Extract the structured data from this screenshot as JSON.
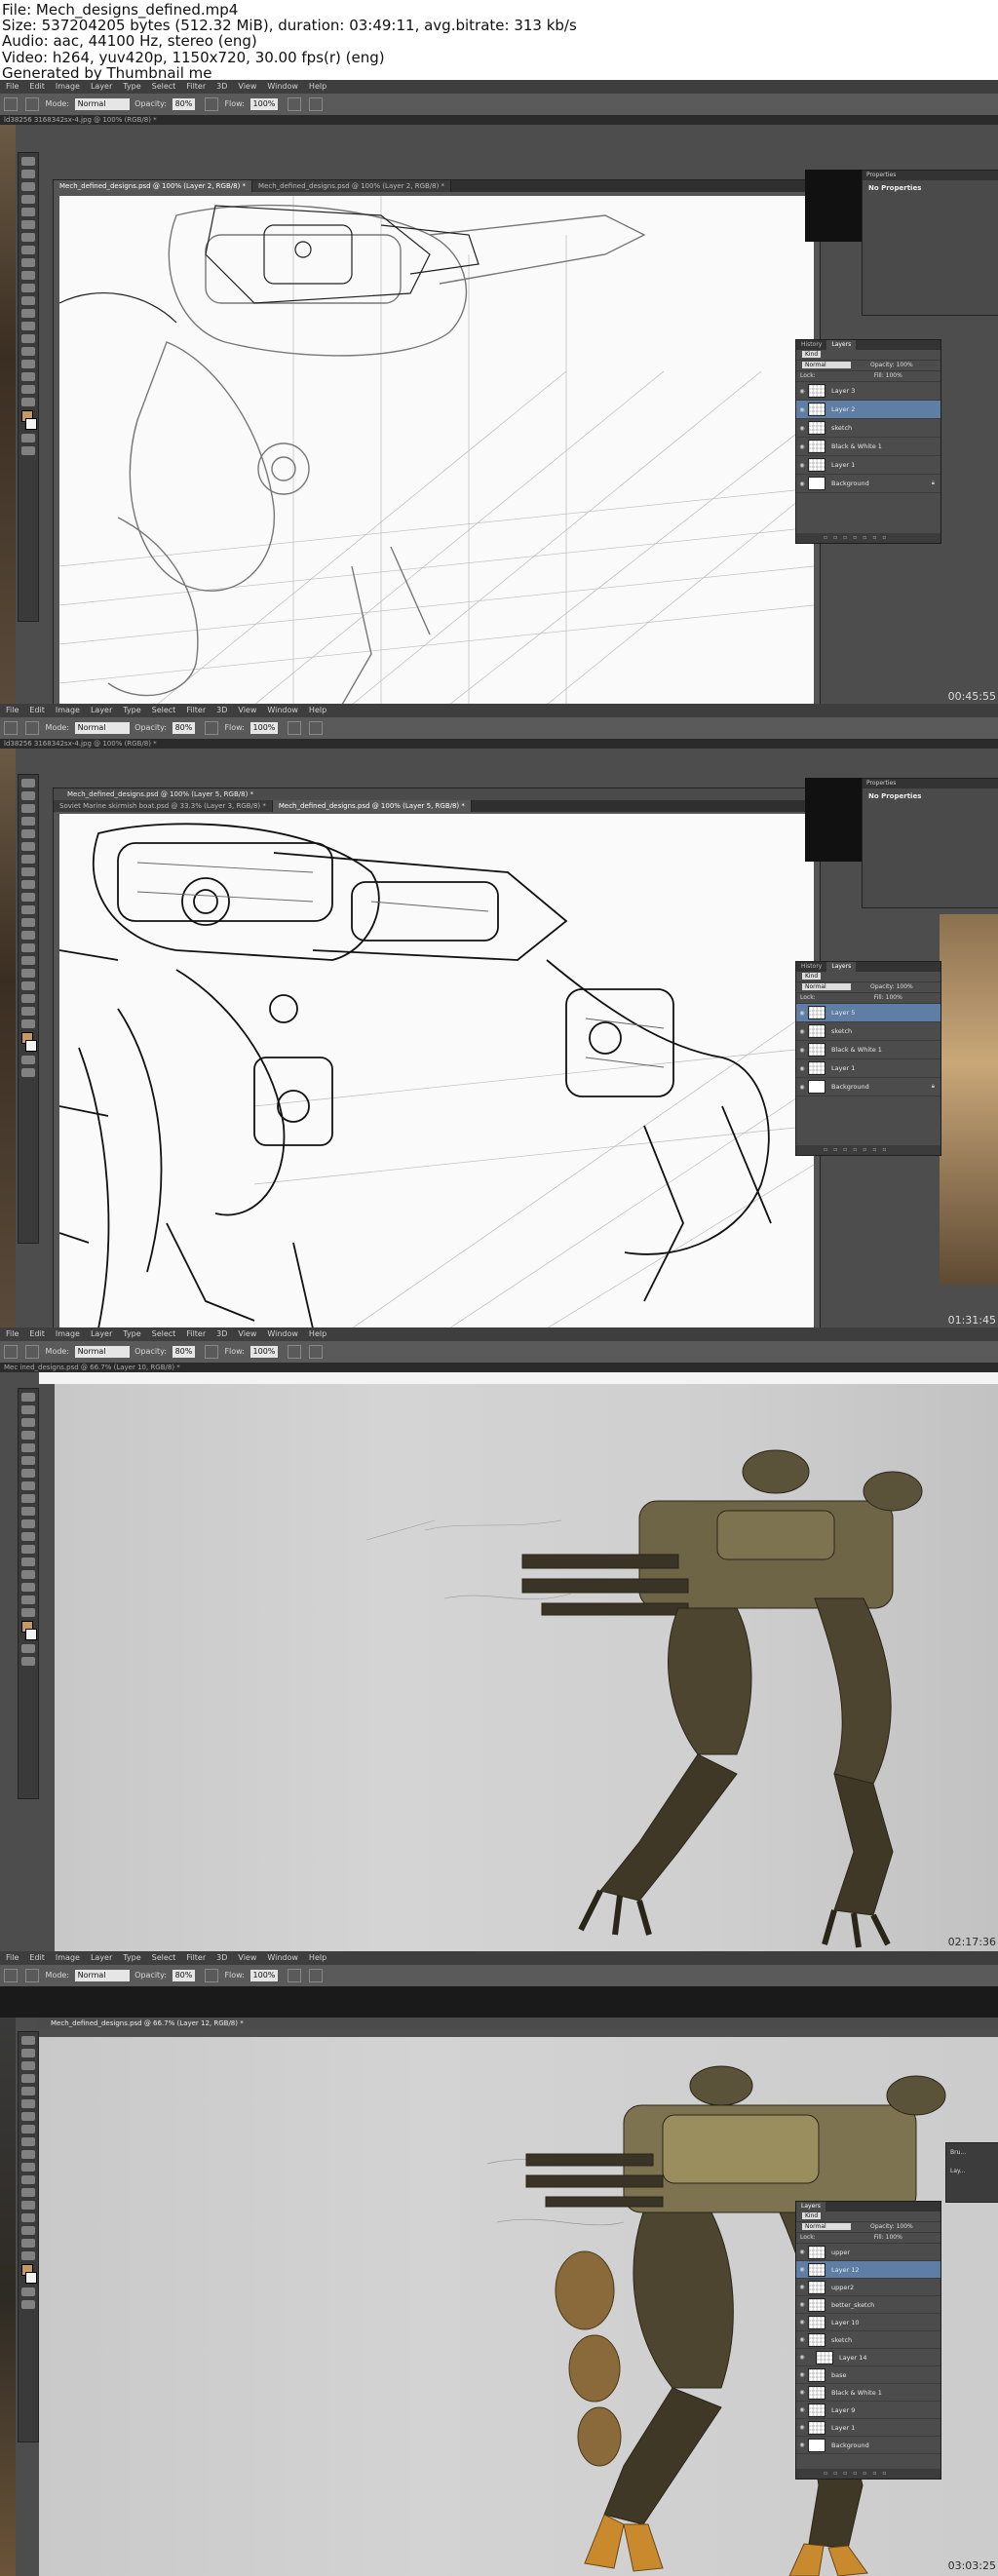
{
  "header": {
    "line1": "File: Mech_designs_defined.mp4",
    "line2": "Size: 537204205 bytes (512.32 MiB), duration: 03:49:11, avg.bitrate: 313 kb/s",
    "line3": "Audio: aac, 44100 Hz, stereo (eng)",
    "line4": "Video: h264, yuv420p, 1150x720, 30.00 fps(r) (eng)",
    "line5": "Generated by Thumbnail me"
  },
  "menu": [
    "File",
    "Edit",
    "Image",
    "Layer",
    "Type",
    "Select",
    "Filter",
    "3D",
    "View",
    "Window",
    "Help"
  ],
  "options": {
    "mode_label": "Mode:",
    "mode_value": "Normal",
    "opacity_label": "Opacity:",
    "opacity_value": "80%",
    "flow_label": "Flow:",
    "flow_value": "100%"
  },
  "frames": [
    {
      "timestamp": "00:45:55",
      "pathline": "ld38256 3168342sx-4.jpg @ 100% (RGB/8) *",
      "tabs": [
        "Mech_defined_designs.psd @ 100% (Layer 2, RGB/8) *",
        "Mech_defined_designs.psd @ 100% (Layer 2, RGB/8) *"
      ],
      "props_title": "Properties",
      "props_body": "No Properties",
      "layers_tabs": [
        "History",
        "Layers"
      ],
      "kind": "Kind",
      "blend": "Normal",
      "opacity": "Opacity: 100%",
      "lock": "Lock:",
      "fill": "Fill: 100%",
      "layers": [
        {
          "name": "Layer 3",
          "thumb": "checker"
        },
        {
          "name": "Layer 2",
          "thumb": "checker"
        },
        {
          "name": "sketch",
          "thumb": "checker"
        },
        {
          "name": "Black & White 1",
          "thumb": "checker"
        },
        {
          "name": "Layer 1",
          "thumb": "checker"
        },
        {
          "name": "Background",
          "thumb": "white"
        }
      ],
      "selected_index": 1
    },
    {
      "timestamp": "01:31:45",
      "pathline": "ld38256 3168342sx-4.jpg @ 100% (RGB/8) *",
      "tabs": [
        "Soviet Marine skirmish boat.psd @ 33.3% (Layer 3, RGB/8) *",
        "Mech_defined_designs.psd @ 100% (Layer 5, RGB/8) *"
      ],
      "props_title": "Properties",
      "props_body": "No Properties",
      "layers_tabs": [
        "History",
        "Layers"
      ],
      "kind": "Kind",
      "blend": "Normal",
      "opacity": "Opacity: 100%",
      "lock": "Lock:",
      "fill": "Fill: 100%",
      "layers": [
        {
          "name": "Layer 5",
          "thumb": "checker"
        },
        {
          "name": "sketch",
          "thumb": "checker"
        },
        {
          "name": "Black & White 1",
          "thumb": "checker"
        },
        {
          "name": "Layer 1",
          "thumb": "checker"
        },
        {
          "name": "Background",
          "thumb": "white"
        }
      ],
      "selected_index": 0
    },
    {
      "timestamp": "02:17:36",
      "pathline": "Mec  ined_designs.psd @ 66.7% (Layer 10, RGB/8) *"
    },
    {
      "timestamp": "03:03:25",
      "tab": "Mech_defined_designs.psd @ 66.7% (Layer 12, RGB/8) *",
      "layers_tabs": [
        "Layers"
      ],
      "kind": "Kind",
      "blend": "Normal",
      "opacity": "Opacity: 100%",
      "lock": "Lock:",
      "fill": "Fill: 100%",
      "layers": [
        {
          "name": "upper",
          "thumb": "checker"
        },
        {
          "name": "Layer 12",
          "thumb": "checker"
        },
        {
          "name": "upper2",
          "thumb": "checker"
        },
        {
          "name": "better_sketch",
          "thumb": "checker"
        },
        {
          "name": "Layer 10",
          "thumb": "checker"
        },
        {
          "name": "sketch",
          "thumb": "checker"
        },
        {
          "name": "Layer 14",
          "thumb": "checker"
        },
        {
          "name": "base",
          "thumb": "checker"
        },
        {
          "name": "Black & White 1",
          "thumb": "checker"
        },
        {
          "name": "Layer 9",
          "thumb": "checker"
        },
        {
          "name": "Layer 1",
          "thumb": "checker"
        },
        {
          "name": "Background",
          "thumb": "white"
        }
      ],
      "selected_index": 1,
      "side_labels": [
        "Bru...",
        "Lay..."
      ]
    }
  ]
}
